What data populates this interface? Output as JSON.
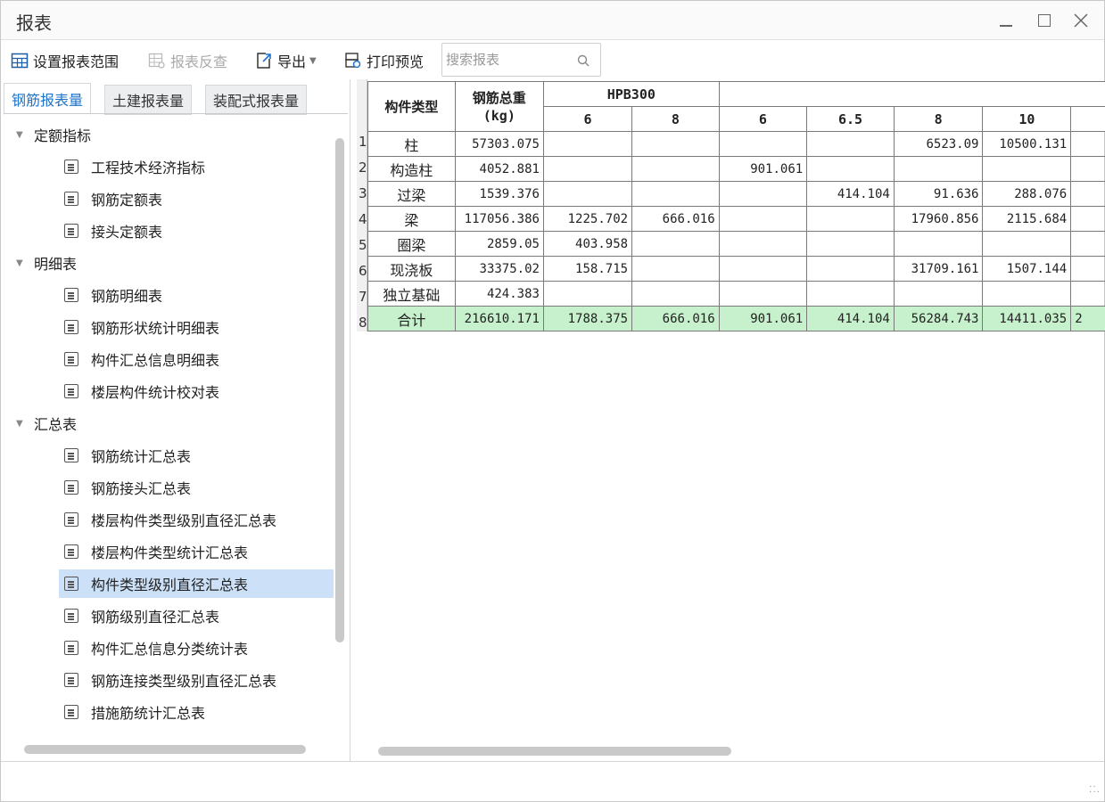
{
  "window": {
    "title": "报表"
  },
  "toolbar": {
    "set_range": "设置报表范围",
    "reverse_check": "报表反查",
    "export": "导出",
    "print_preview": "打印预览",
    "search_placeholder": "搜索报表"
  },
  "tabs": [
    {
      "label": "钢筋报表量",
      "active": true
    },
    {
      "label": "土建报表量",
      "active": false
    },
    {
      "label": "装配式报表量",
      "active": false
    }
  ],
  "tree": {
    "groups": [
      {
        "label": "定额指标",
        "items": [
          "工程技术经济指标",
          "钢筋定额表",
          "接头定额表"
        ]
      },
      {
        "label": "明细表",
        "items": [
          "钢筋明细表",
          "钢筋形状统计明细表",
          "构件汇总信息明细表",
          "楼层构件统计校对表"
        ]
      },
      {
        "label": "汇总表",
        "items": [
          "钢筋统计汇总表",
          "钢筋接头汇总表",
          "楼层构件类型级别直径汇总表",
          "楼层构件类型统计汇总表",
          "构件类型级别直径汇总表",
          "钢筋级别直径汇总表",
          "构件汇总信息分类统计表",
          "钢筋连接类型级别直径汇总表",
          "措施筋统计汇总表"
        ]
      }
    ],
    "selected": "构件类型级别直径汇总表"
  },
  "table": {
    "header": {
      "type": "构件类型",
      "total_weight_line1": "钢筋总重",
      "total_weight_line2": "(kg)",
      "group1": "HPB300",
      "diameters": [
        "6",
        "8",
        "6",
        "6.5",
        "8",
        "10"
      ]
    },
    "rows": [
      {
        "no": "1",
        "name": "柱",
        "total": "57303.075",
        "c": [
          "",
          "",
          "",
          "",
          "6523.09",
          "10500.131"
        ]
      },
      {
        "no": "2",
        "name": "构造柱",
        "total": "4052.881",
        "c": [
          "",
          "",
          "901.061",
          "",
          "",
          ""
        ]
      },
      {
        "no": "3",
        "name": "过梁",
        "total": "1539.376",
        "c": [
          "",
          "",
          "",
          "414.104",
          "91.636",
          "288.076"
        ]
      },
      {
        "no": "4",
        "name": "梁",
        "total": "117056.386",
        "c": [
          "1225.702",
          "666.016",
          "",
          "",
          "17960.856",
          "2115.684"
        ]
      },
      {
        "no": "5",
        "name": "圈梁",
        "total": "2859.05",
        "c": [
          "403.958",
          "",
          "",
          "",
          "",
          ""
        ]
      },
      {
        "no": "6",
        "name": "现浇板",
        "total": "33375.02",
        "c": [
          "158.715",
          "",
          "",
          "",
          "31709.161",
          "1507.144"
        ]
      },
      {
        "no": "7",
        "name": "独立基础",
        "total": "424.383",
        "c": [
          "",
          "",
          "",
          "",
          "",
          ""
        ]
      },
      {
        "no": "8",
        "name": "合计",
        "total": "216610.171",
        "c": [
          "1788.375",
          "666.016",
          "901.061",
          "414.104",
          "56284.743",
          "14411.035"
        ],
        "extra": "2",
        "total_row": true
      }
    ]
  }
}
